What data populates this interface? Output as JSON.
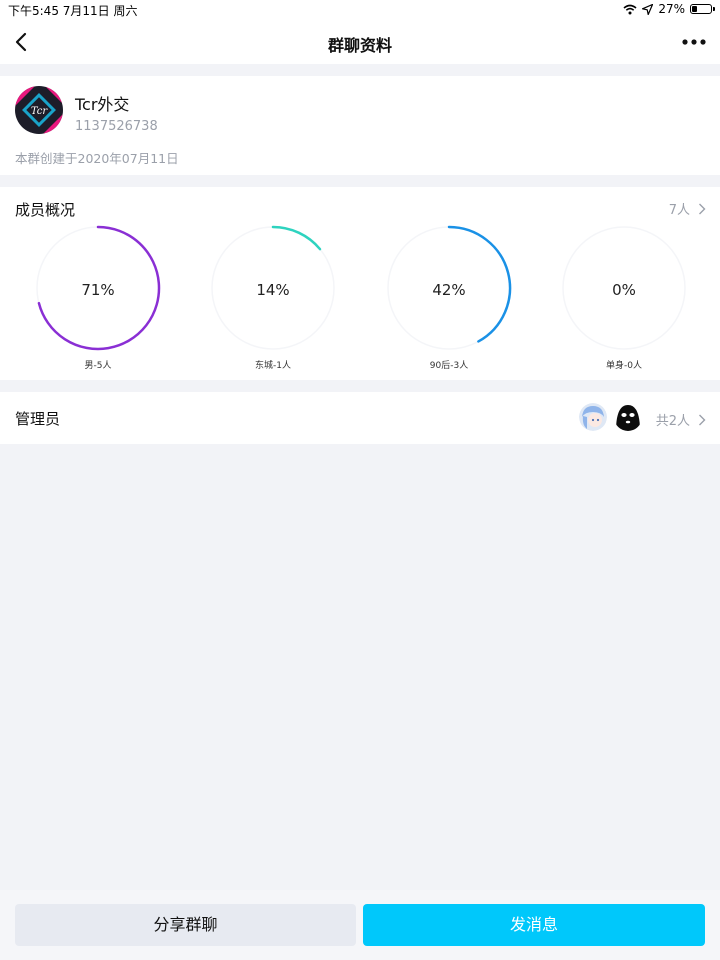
{
  "status_bar": {
    "time_date": "下午5:45   7月11日 周六",
    "battery": "27%",
    "battery_level": 0.27
  },
  "nav": {
    "title": "群聊资料"
  },
  "group": {
    "name": "Tcr外交",
    "id": "1137526738",
    "created": "本群创建于2020年07月11日"
  },
  "members": {
    "title": "成员概况",
    "count": "7人",
    "stats": [
      {
        "percent": "71%",
        "label": "男-5人",
        "fraction": 0.71,
        "color": "#8a2fd4"
      },
      {
        "percent": "14%",
        "label": "东城-1人",
        "fraction": 0.14,
        "color": "#2ed3bf"
      },
      {
        "percent": "42%",
        "label": "90后-3人",
        "fraction": 0.42,
        "color": "#1a91e6"
      },
      {
        "percent": "0%",
        "label": "单身-0人",
        "fraction": 0.0,
        "color": "#cccccc"
      }
    ]
  },
  "admins": {
    "title": "管理员",
    "count": "共2人"
  },
  "actions": {
    "share": "分享群聊",
    "send": "发消息"
  },
  "colors": {
    "accent": "#00c8fb",
    "background": "#f2f3f7",
    "muted_text": "#9ba0aa"
  }
}
